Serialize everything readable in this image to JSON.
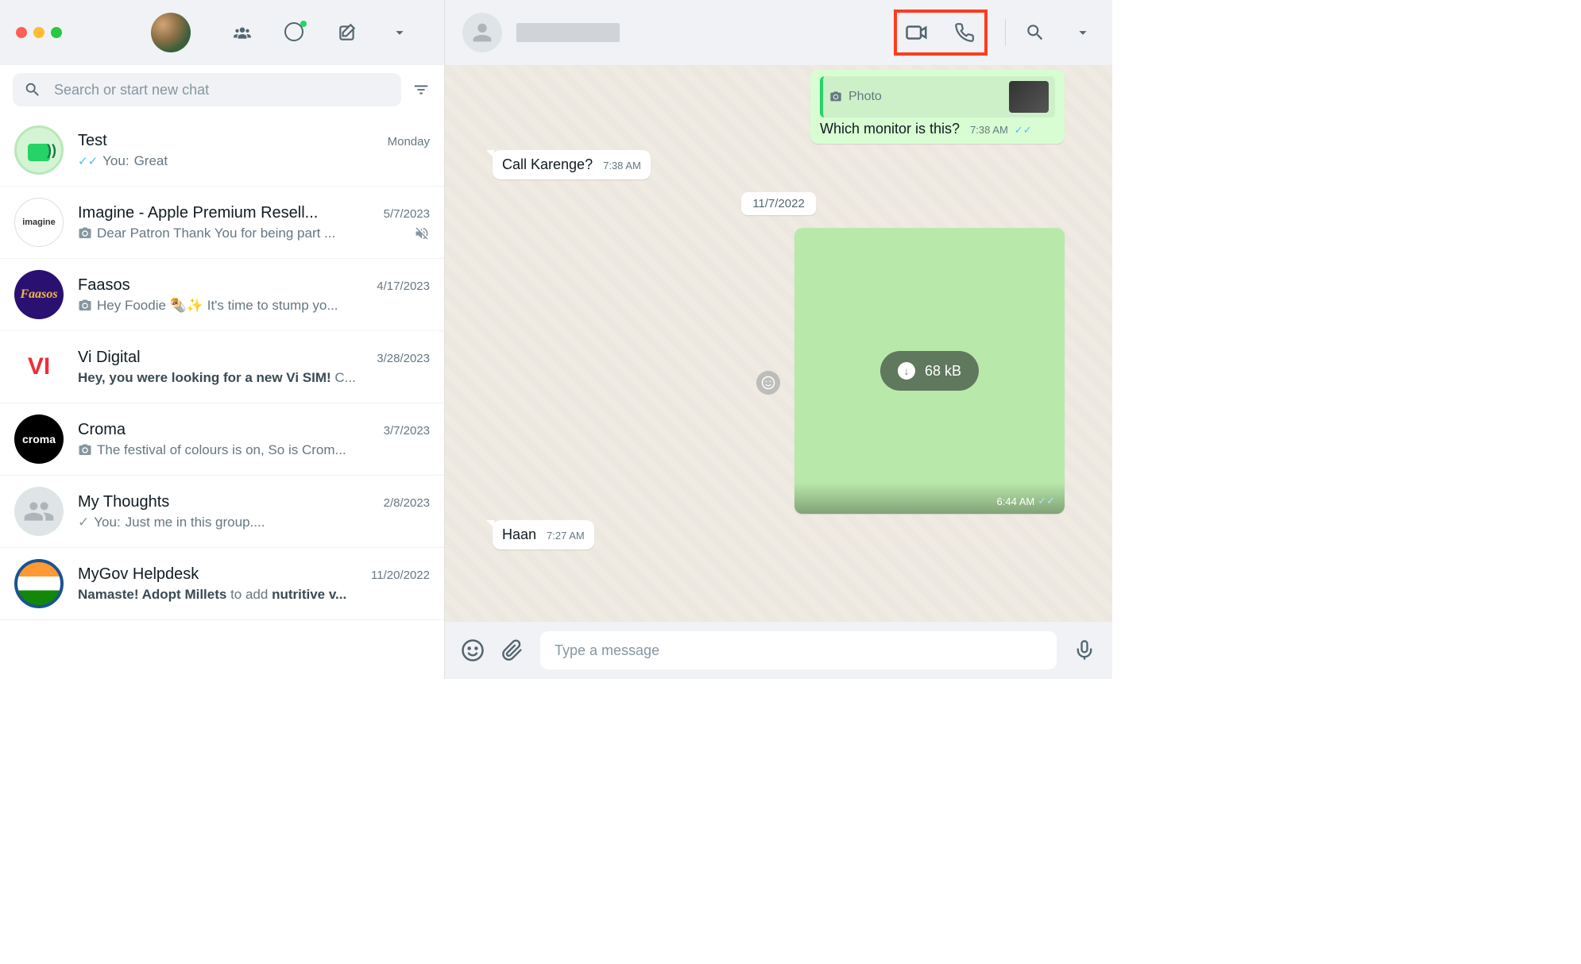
{
  "sidebar": {
    "search_placeholder": "Search or start new chat"
  },
  "chats": [
    {
      "name": "Test",
      "time": "Monday",
      "preview_prefix": "You: ",
      "preview": "Great",
      "has_dbl_check": true,
      "avatar_class": "avatar-test avatar-test-outer",
      "avatar_text": ""
    },
    {
      "name": "Imagine - Apple Premium Resell...",
      "time": "5/7/2023",
      "preview_prefix": "",
      "preview": "Dear Patron Thank You for being part ...",
      "has_camera": true,
      "muted": true,
      "avatar_class": "avatar-imagine",
      "avatar_text": "imagine"
    },
    {
      "name": "Faasos",
      "time": "4/17/2023",
      "preview_prefix": "",
      "preview": "Hey Foodie 🌯✨ It's time to stump yo...",
      "has_camera": true,
      "avatar_class": "avatar-faasos",
      "avatar_text": "Faasos"
    },
    {
      "name": "Vi Digital",
      "time": "3/28/2023",
      "preview_prefix": "",
      "preview_html": "<strong>Hey, you were looking for a new Vi SIM!</strong> C...",
      "avatar_class": "avatar-vi",
      "avatar_text": "VI"
    },
    {
      "name": "Croma",
      "time": "3/7/2023",
      "preview_prefix": "",
      "preview": "The festival of colours is on,  So is Crom...",
      "has_camera": true,
      "avatar_class": "avatar-croma",
      "avatar_text": "croma"
    },
    {
      "name": "My Thoughts",
      "time": "2/8/2023",
      "preview_prefix": "You: ",
      "preview": "Just me in this group....",
      "has_sent_tick": true,
      "avatar_class": "avatar-mythoughts",
      "avatar_text": "",
      "avatar_svg": true
    },
    {
      "name": "MyGov Helpdesk",
      "time": "11/20/2022",
      "preview_prefix": "",
      "preview_html": "<strong>Namaste! Adopt Millets</strong> to add <strong>nutritive v...</strong>",
      "avatar_class": "avatar-mygov",
      "avatar_text": ""
    }
  ],
  "conversation": {
    "quoted_label": "Photo",
    "out1_text": "Which monitor is this?",
    "out1_time": "7:38 AM",
    "in1_text": "Call Karenge?",
    "in1_time": "7:38 AM",
    "date_chip": "11/7/2022",
    "download_size": "68 kB",
    "img_time": "6:44 AM",
    "in2_text": "Haan",
    "in2_time": "7:27 AM"
  },
  "input": {
    "placeholder": "Type a message"
  }
}
